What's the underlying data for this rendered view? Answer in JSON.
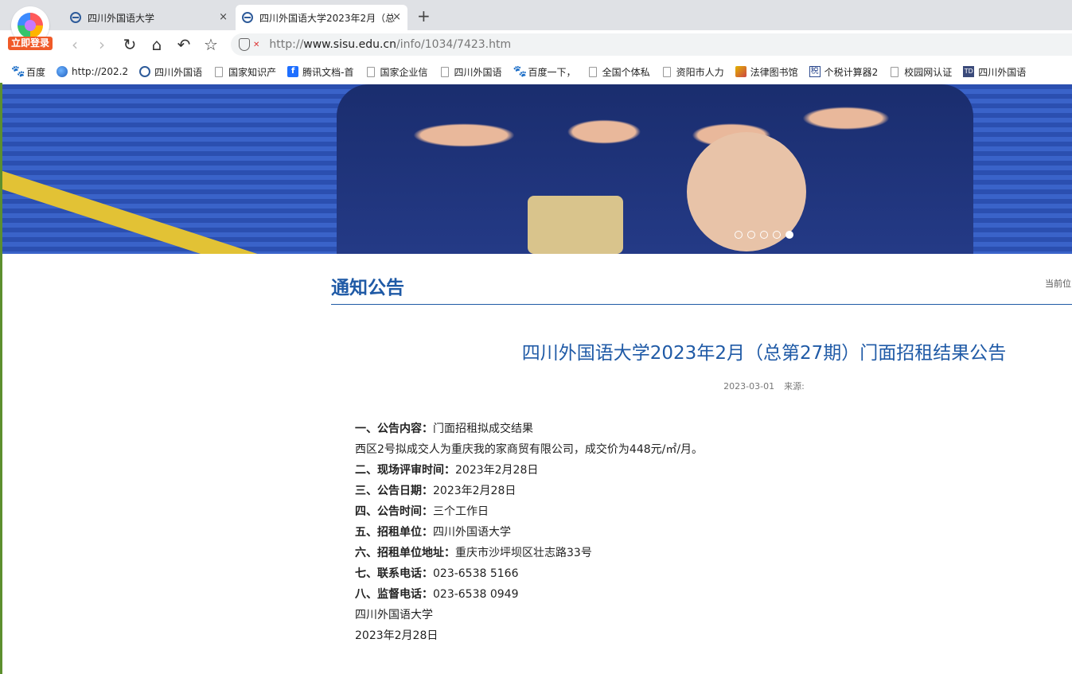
{
  "browser": {
    "login_badge": "立即登录",
    "tabs": [
      {
        "title": "四川外国语大学",
        "close": "×"
      },
      {
        "title": "四川外国语大学2023年2月（总",
        "close": "×"
      }
    ],
    "new_tab": "+",
    "address": {
      "prefix": "http://",
      "host": "www.sisu.edu.cn",
      "path": "/info/1034/7423.htm"
    },
    "bookmarks": [
      {
        "label": "百度",
        "icon": "paw-icon"
      },
      {
        "label": "http://202.2",
        "icon": "globe-icon"
      },
      {
        "label": "四川外国语",
        "icon": "university-icon"
      },
      {
        "label": "国家知识产",
        "icon": "page-icon"
      },
      {
        "label": "腾讯文档-首",
        "icon": "tencent-docs-icon"
      },
      {
        "label": "国家企业信",
        "icon": "page-icon"
      },
      {
        "label": "四川外国语",
        "icon": "page-icon"
      },
      {
        "label": "百度一下，",
        "icon": "paw-icon"
      },
      {
        "label": "全国个体私",
        "icon": "page-icon"
      },
      {
        "label": "资阳市人力",
        "icon": "page-icon"
      },
      {
        "label": "法律图书馆",
        "icon": "law-icon"
      },
      {
        "label": "个税计算器2",
        "icon": "tax-icon"
      },
      {
        "label": "校园网认证",
        "icon": "page-icon"
      },
      {
        "label": "四川外国语",
        "icon": "td-icon"
      }
    ]
  },
  "banner": {
    "slides": 5,
    "active_slide": 5
  },
  "page": {
    "section_title": "通知公告",
    "breadcrumb": "当前位",
    "article_title": "四川外国语大学2023年2月（总第27期）门面招租结果公告",
    "date": "2023-03-01",
    "source": "来源:",
    "lines": [
      {
        "label": "一、公告内容：",
        "text": "门面招租拟成交结果"
      },
      {
        "label": "",
        "text": "西区2号拟成交人为重庆我的家商贸有限公司，成交价为448元/㎡/月。"
      },
      {
        "label": "二、现场评审时间：",
        "text": "2023年2月28日"
      },
      {
        "label": "三、公告日期：",
        "text": "2023年2月28日"
      },
      {
        "label": "四、公告时间：",
        "text": "三个工作日"
      },
      {
        "label": "五、招租单位：",
        "text": "四川外国语大学"
      },
      {
        "label": "六、招租单位地址：",
        "text": "重庆市沙坪坝区壮志路33号"
      },
      {
        "label": "七、联系电话：",
        "text": "023-6538 5166"
      },
      {
        "label": "八、监督电话：",
        "text": "023-6538 0949"
      },
      {
        "label": "",
        "text": "四川外国语大学"
      },
      {
        "label": "",
        "text": "2023年2月28日"
      }
    ]
  }
}
